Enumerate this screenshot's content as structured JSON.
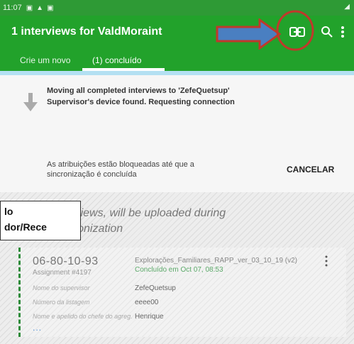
{
  "statusbar": {
    "time": "11:07"
  },
  "appbar": {
    "title": "1 interviews for ValdMoraint",
    "tabs": [
      {
        "label": "Crie um novo"
      },
      {
        "label": "(1) concluído"
      }
    ]
  },
  "sync": {
    "line1": "Moving all completed interviews to 'ZefeQuetsup'",
    "line2": "Supervisor's device found. Requesting connection",
    "lock_line1": "As atribuições estão bloqueadas até que a",
    "lock_line2": "sincronização é concluída",
    "cancel_label": "CANCELAR"
  },
  "upload": {
    "line1": "nterviews, will be uploaded during",
    "line2": "nchronization"
  },
  "overlay": {
    "line1": "lo",
    "line2": "dor/Rece"
  },
  "interview": {
    "id": "06-80-10-93",
    "assignment": "Assignment #4197",
    "questionnaire": "Explorações_Familiares_RAPP_ver_03_10_19 (v2)",
    "status": "Concluído em Oct 07, 08:53",
    "fields": [
      {
        "label": "Nome do supervisor",
        "value": "ZefeQuetsup"
      },
      {
        "label": "Número da listagem",
        "value": "eeee00"
      },
      {
        "label": "Nome e apelido do chefe do agreg.",
        "value": "Henrique"
      }
    ],
    "more": "..."
  },
  "colors": {
    "appbar": "#22a22b",
    "annotation_red": "#c0392b",
    "annotation_blue": "#4a7fc1"
  }
}
